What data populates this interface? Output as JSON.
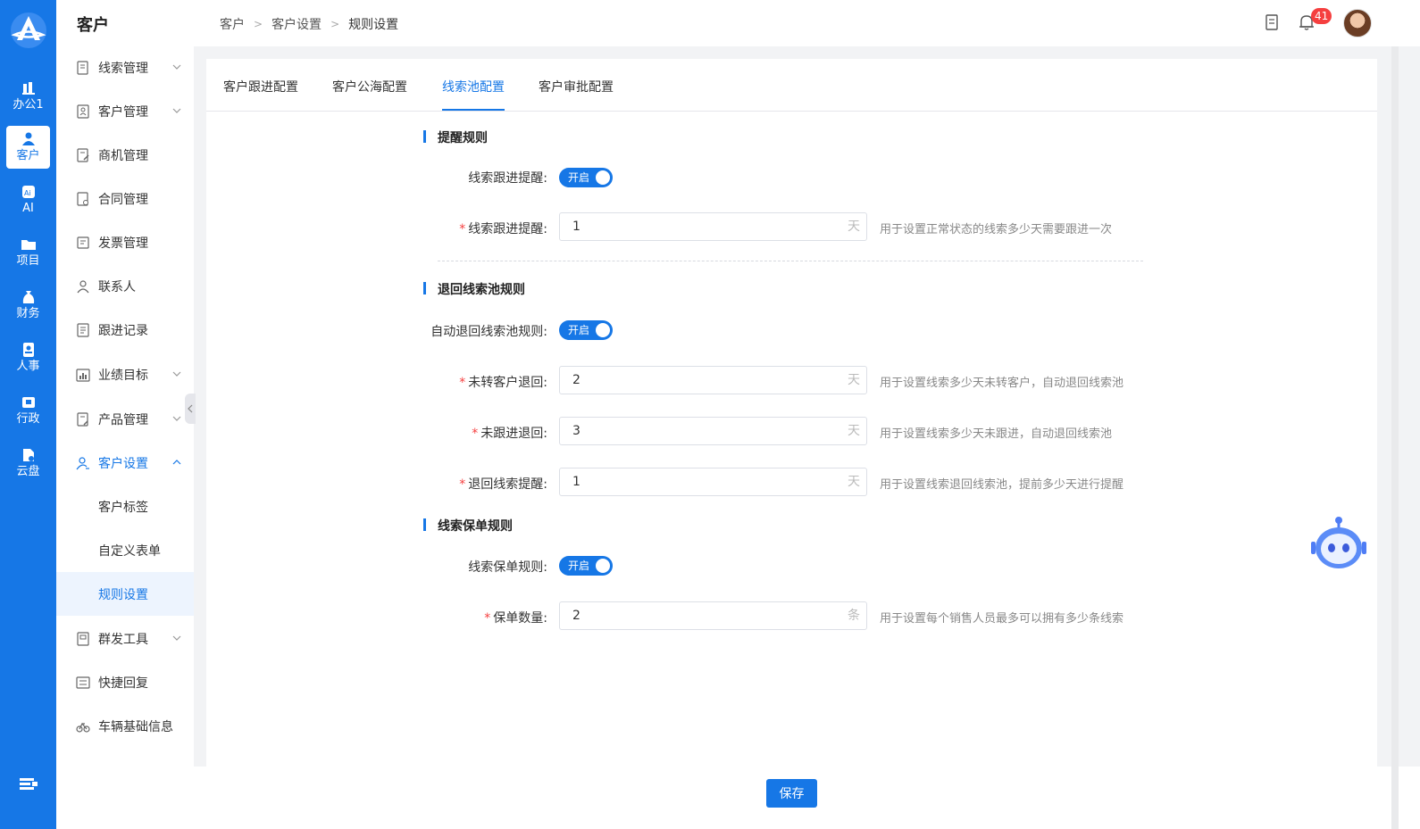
{
  "rail": {
    "items": [
      {
        "label": "办公1",
        "icon": "office-icon"
      },
      {
        "label": "客户",
        "icon": "customer-icon"
      },
      {
        "label": "AI",
        "icon": "ai-icon"
      },
      {
        "label": "项目",
        "icon": "project-icon"
      },
      {
        "label": "财务",
        "icon": "finance-icon"
      },
      {
        "label": "人事",
        "icon": "hr-icon"
      },
      {
        "label": "行政",
        "icon": "admin-icon"
      },
      {
        "label": "云盘",
        "icon": "cloud-drive-icon"
      }
    ]
  },
  "sidebar": {
    "title": "客户",
    "items": [
      {
        "label": "线索管理"
      },
      {
        "label": "客户管理"
      },
      {
        "label": "商机管理"
      },
      {
        "label": "合同管理"
      },
      {
        "label": "发票管理"
      },
      {
        "label": "联系人"
      },
      {
        "label": "跟进记录"
      },
      {
        "label": "业绩目标"
      },
      {
        "label": "产品管理"
      },
      {
        "label": "客户设置"
      },
      {
        "label": "客户标签"
      },
      {
        "label": "自定义表单"
      },
      {
        "label": "规则设置"
      },
      {
        "label": "群发工具"
      },
      {
        "label": "快捷回复"
      },
      {
        "label": "车辆基础信息"
      }
    ]
  },
  "header": {
    "breadcrumb": [
      "客户",
      "客户设置",
      "规则设置"
    ],
    "notification_count": "41"
  },
  "tabs": [
    "客户跟进配置",
    "客户公海配置",
    "线索池配置",
    "客户审批配置"
  ],
  "sections": {
    "reminder": {
      "title": "提醒规则"
    },
    "return": {
      "title": "退回线索池规则"
    },
    "protect": {
      "title": "线索保单规则"
    }
  },
  "form": {
    "follow_remind_switch_label": "线索跟进提醒:",
    "follow_remind_days_label": "线索跟进提醒:",
    "follow_remind_days_value": "1",
    "follow_remind_hint": "用于设置正常状态的线索多少天需要跟进一次",
    "auto_return_switch_label": "自动退回线索池规则:",
    "unconverted_label": "未转客户退回:",
    "unconverted_value": "2",
    "unconverted_hint": "用于设置线索多少天未转客户，自动退回线索池",
    "no_follow_label": "未跟进退回:",
    "no_follow_value": "3",
    "no_follow_hint": "用于设置线索多少天未跟进，自动退回线索池",
    "return_remind_label": "退回线索提醒:",
    "return_remind_value": "1",
    "return_remind_hint": "用于设置线索退回线索池，提前多少天进行提醒",
    "protect_switch_label": "线索保单规则:",
    "protect_count_label": "保单数量:",
    "protect_count_value": "2",
    "protect_count_hint": "用于设置每个销售人员最多可以拥有多少条线索",
    "switch_on_text": "开启",
    "unit_day": "天",
    "unit_item": "条"
  },
  "footer": {
    "save_label": "保存"
  },
  "colors": {
    "primary": "#1677e6",
    "danger": "#f53f3f"
  }
}
